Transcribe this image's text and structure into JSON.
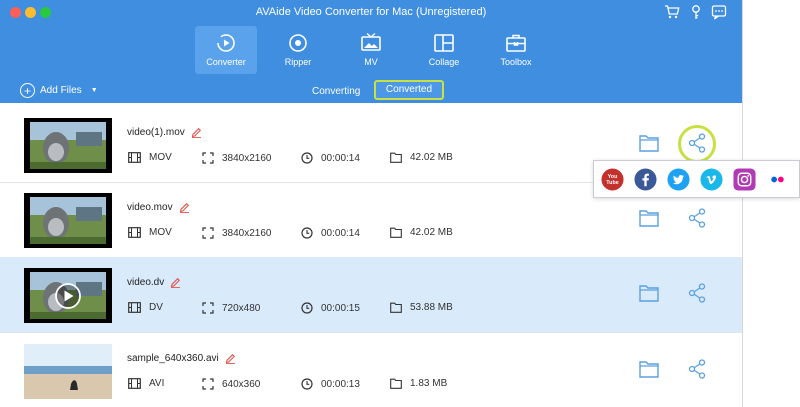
{
  "app": {
    "title": "AVAide Video Converter for Mac (Unregistered)"
  },
  "tabs": [
    {
      "label": "Converter",
      "active": true
    },
    {
      "label": "Ripper",
      "active": false
    },
    {
      "label": "MV",
      "active": false
    },
    {
      "label": "Collage",
      "active": false
    },
    {
      "label": "Toolbox",
      "active": false
    }
  ],
  "toolbar": {
    "add_files_label": "Add Files"
  },
  "subtabs": {
    "converting": "Converting",
    "converted": "Converted",
    "selected": "Converted"
  },
  "files": [
    {
      "name": "video(1).mov",
      "format": "MOV",
      "resolution": "3840x2160",
      "duration": "00:00:14",
      "size": "42.02 MB"
    },
    {
      "name": "video.mov",
      "format": "MOV",
      "resolution": "3840x2160",
      "duration": "00:00:14",
      "size": "42.02 MB"
    },
    {
      "name": "video.dv",
      "format": "DV",
      "resolution": "720x480",
      "duration": "00:00:15",
      "size": "53.88 MB"
    },
    {
      "name": "sample_640x360.avi",
      "format": "AVI",
      "resolution": "640x360",
      "duration": "00:00:13",
      "size": "1.83 MB"
    }
  ],
  "share_menu": {
    "youtube_text": "You Tube",
    "items": [
      "youtube-icon",
      "facebook-icon",
      "twitter-icon",
      "vimeo-icon",
      "instagram-icon",
      "flickr-icon"
    ]
  },
  "colors": {
    "header_blue": "#3f8ee0",
    "highlight_green": "#c8e042",
    "selected_row": "#d9eafb",
    "icon_blue": "#5aa0e0"
  }
}
